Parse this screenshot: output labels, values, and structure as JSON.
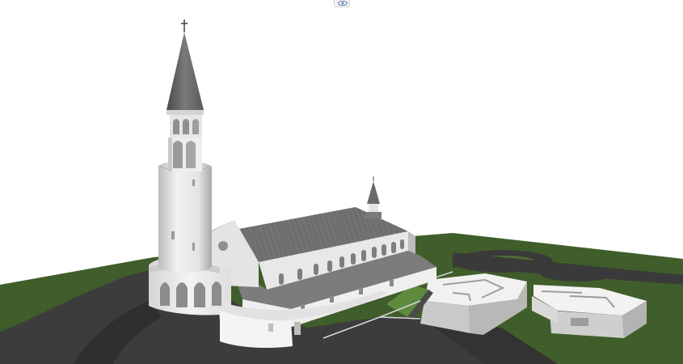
{
  "viewer": {
    "toggle_icon": "eye-icon"
  },
  "colors": {
    "background": "#ffffff",
    "grass": "#3f5d2a",
    "asphalt": "#3c3c3c",
    "roof": "#6e6e6e",
    "wall": "#e9e9e9"
  }
}
